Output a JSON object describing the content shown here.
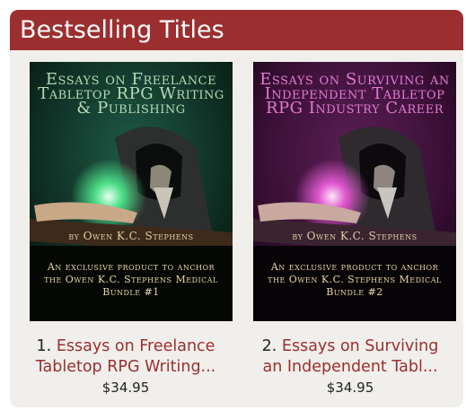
{
  "section": {
    "title": "Bestselling Titles"
  },
  "products": [
    {
      "rank": "1.",
      "title_line1": "Essays on Freelance",
      "title_line2": "Tabletop RPG Writing...",
      "price": "$34.95",
      "cover": {
        "title": "Essays on Freelance Tabletop RPG Writing & Publishing",
        "author": "by Owen K.C. Stephens",
        "blurb": "An exclusive product to anchor the Owen K.C. Stephens Medical Bundle #1",
        "title_color": "#b7d9b8",
        "glow_color": "#4fe08a",
        "bg_color": "#0f2f24"
      }
    },
    {
      "rank": "2.",
      "title_line1": "Essays on Surviving",
      "title_line2": "an Independent Tabl...",
      "price": "$34.95",
      "cover": {
        "title": "Essays on Surviving an Independent Tabletop RPG Industry Career",
        "author": "by Owen K.C. Stephens",
        "blurb": "An exclusive product to anchor the Owen K.C. Stephens Medical Bundle #2",
        "title_color": "#e27ad0",
        "glow_color": "#e05ad0",
        "bg_color": "#3a0f36"
      }
    }
  ],
  "colors": {
    "header_bg": "#9b2f2f",
    "panel_bg": "#f0efeb",
    "link": "#9b2f2f"
  }
}
